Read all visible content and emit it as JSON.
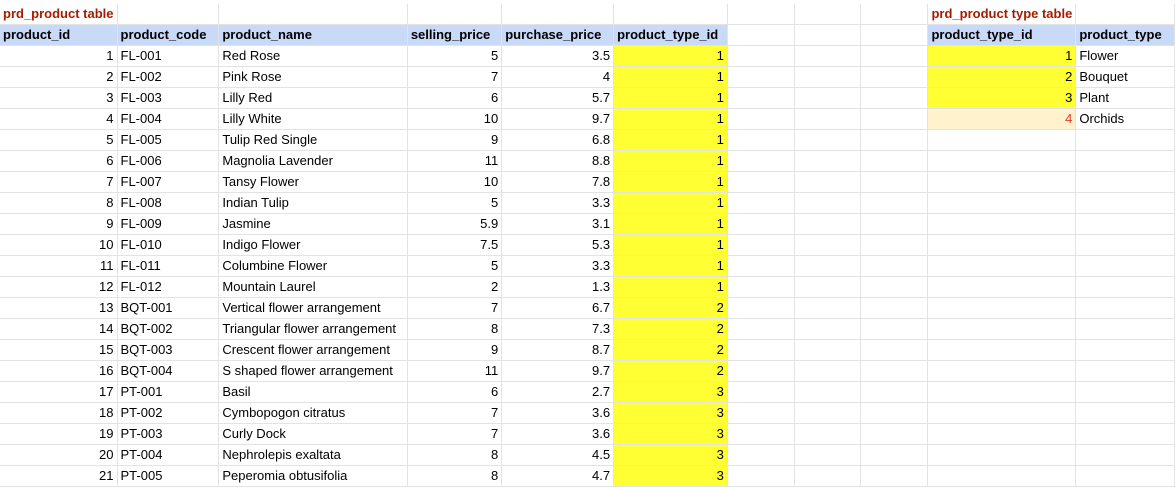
{
  "product_table": {
    "title": "prd_product table",
    "columns": [
      "product_id",
      "product_code",
      "product_name",
      "selling_price",
      "purchase_price",
      "product_type_id"
    ],
    "rows": [
      [
        "1",
        "FL-001",
        "Red Rose",
        "5",
        "3.5",
        "1"
      ],
      [
        "2",
        "FL-002",
        "Pink Rose",
        "7",
        "4",
        "1"
      ],
      [
        "3",
        "FL-003",
        "Lilly Red",
        "6",
        "5.7",
        "1"
      ],
      [
        "4",
        "FL-004",
        "Lilly White",
        "10",
        "9.7",
        "1"
      ],
      [
        "5",
        "FL-005",
        "Tulip Red Single",
        "9",
        "6.8",
        "1"
      ],
      [
        "6",
        "FL-006",
        "Magnolia Lavender",
        "11",
        "8.8",
        "1"
      ],
      [
        "7",
        "FL-007",
        "Tansy Flower",
        "10",
        "7.8",
        "1"
      ],
      [
        "8",
        "FL-008",
        "Indian Tulip",
        "5",
        "3.3",
        "1"
      ],
      [
        "9",
        "FL-009",
        "Jasmine",
        "5.9",
        "3.1",
        "1"
      ],
      [
        "10",
        "FL-010",
        "Indigo Flower",
        "7.5",
        "5.3",
        "1"
      ],
      [
        "11",
        "FL-011",
        "Columbine Flower",
        "5",
        "3.3",
        "1"
      ],
      [
        "12",
        "FL-012",
        "Mountain Laurel",
        "2",
        "1.3",
        "1"
      ],
      [
        "13",
        "BQT-001",
        "Vertical flower arrangement",
        "7",
        "6.7",
        "2"
      ],
      [
        "14",
        "BQT-002",
        "Triangular flower arrangement",
        "8",
        "7.3",
        "2"
      ],
      [
        "15",
        "BQT-003",
        "Crescent flower arrangement",
        "9",
        "8.7",
        "2"
      ],
      [
        "16",
        "BQT-004",
        "S shaped flower arrangement",
        "11",
        "9.7",
        "2"
      ],
      [
        "17",
        "PT-001",
        "Basil",
        "6",
        "2.7",
        "3"
      ],
      [
        "18",
        "PT-002",
        "Cymbopogon citratus",
        "7",
        "3.6",
        "3"
      ],
      [
        "19",
        "PT-003",
        "Curly Dock",
        "7",
        "3.6",
        "3"
      ],
      [
        "20",
        "PT-004",
        "Nephrolepis exaltata",
        "8",
        "4.5",
        "3"
      ],
      [
        "21",
        "PT-005",
        "Peperomia obtusifolia",
        "8",
        "4.7",
        "3"
      ]
    ]
  },
  "type_table": {
    "title": "prd_product type table",
    "columns": [
      "product_type_id",
      "product_type"
    ],
    "rows": [
      [
        "1",
        "Flower"
      ],
      [
        "2",
        "Bouquet"
      ],
      [
        "3",
        "Plant"
      ],
      [
        "4",
        "Orchids"
      ]
    ]
  },
  "colors": {
    "header_bg": "#c9daf8",
    "title_text": "#a61c00",
    "highlight_yellow": "#ffff33",
    "highlight_peach": "#fff2cc",
    "missing_id_text": "#e53935",
    "gridline": "#e2e3e3"
  }
}
